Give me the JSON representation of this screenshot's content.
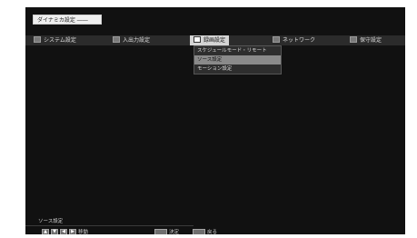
{
  "window": {
    "title": "ダイナミカ設定 ――"
  },
  "menubar": {
    "items": [
      {
        "label": "システム設定",
        "icon": "system-icon",
        "active": false
      },
      {
        "label": "入出力設定",
        "icon": "io-icon",
        "active": false
      },
      {
        "label": "録画設定",
        "icon": "record-icon",
        "active": true
      },
      {
        "label": "ネットワーク",
        "icon": "network-icon",
        "active": false
      },
      {
        "label": "保守設定",
        "icon": "maintenance-icon",
        "active": false
      }
    ]
  },
  "dropdown": {
    "items": [
      {
        "label": "スケジュールモード・リモート",
        "selected": false
      },
      {
        "label": "ソース設定",
        "selected": true
      },
      {
        "label": "モーション設定",
        "selected": false
      }
    ]
  },
  "status": {
    "text": "ソース設定"
  },
  "keys": {
    "arrows_label": "移動",
    "enter_label": "決定",
    "return_label": "戻る"
  }
}
